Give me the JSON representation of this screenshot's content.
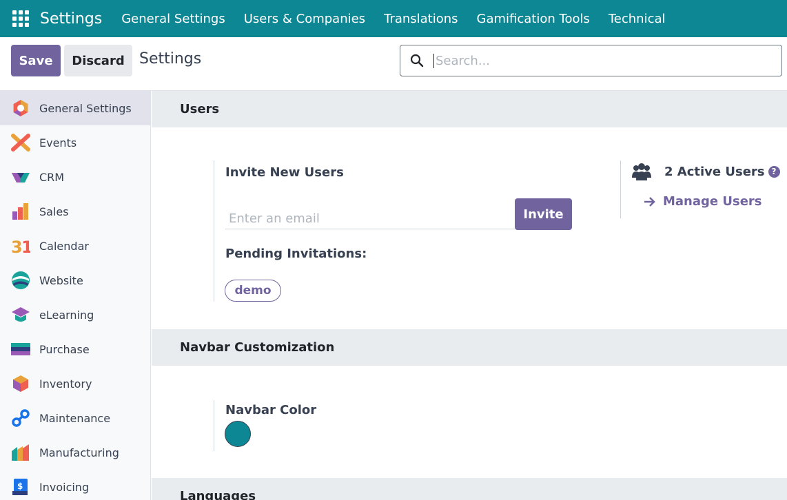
{
  "navbar": {
    "brand": "Settings",
    "items": [
      "General Settings",
      "Users & Companies",
      "Translations",
      "Gamification Tools",
      "Technical"
    ]
  },
  "control_panel": {
    "save_label": "Save",
    "discard_label": "Discard",
    "title": "Settings",
    "search_placeholder": "Search..."
  },
  "sidebar": {
    "items": [
      {
        "label": "General Settings",
        "icon": "general-settings-icon",
        "active": true
      },
      {
        "label": "Events",
        "icon": "events-icon"
      },
      {
        "label": "CRM",
        "icon": "crm-icon"
      },
      {
        "label": "Sales",
        "icon": "sales-icon"
      },
      {
        "label": "Calendar",
        "icon": "calendar-icon"
      },
      {
        "label": "Website",
        "icon": "website-icon"
      },
      {
        "label": "eLearning",
        "icon": "elearning-icon"
      },
      {
        "label": "Purchase",
        "icon": "purchase-icon"
      },
      {
        "label": "Inventory",
        "icon": "inventory-icon"
      },
      {
        "label": "Maintenance",
        "icon": "maintenance-icon"
      },
      {
        "label": "Manufacturing",
        "icon": "manufacturing-icon"
      },
      {
        "label": "Invoicing",
        "icon": "invoicing-icon"
      }
    ]
  },
  "users_section": {
    "heading": "Users",
    "invite_title": "Invite New Users",
    "email_placeholder": "Enter an email",
    "invite_label": "Invite",
    "pending_title": "Pending Invitations:",
    "pending": [
      "demo"
    ],
    "active_users_label": "2 Active Users",
    "help_glyph": "?",
    "manage_users_label": "Manage Users"
  },
  "navbar_section": {
    "heading": "Navbar Customization",
    "color_title": "Navbar Color",
    "color_value": "#0e8794"
  },
  "languages_section": {
    "heading": "Languages"
  },
  "colors": {
    "primary": "#71639e",
    "navbar": "#0e8794"
  }
}
